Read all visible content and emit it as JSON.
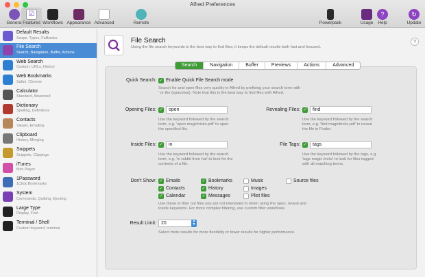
{
  "window": {
    "title": "Alfred Preferences"
  },
  "toolbar": {
    "left": [
      {
        "label": "General",
        "icon": "general-icon"
      },
      {
        "label": "Features",
        "icon": "features-icon"
      },
      {
        "label": "Workflows",
        "icon": "workflows-icon"
      },
      {
        "label": "Appearance",
        "icon": "appearance-icon"
      },
      {
        "label": "Advanced",
        "icon": "advanced-icon"
      },
      {
        "label": "Remote",
        "icon": "remote-icon"
      }
    ],
    "right": [
      {
        "label": "Powerpack",
        "icon": "powerpack-icon"
      },
      {
        "label": "Usage",
        "icon": "usage-icon"
      },
      {
        "label": "Help",
        "icon": "help-icon"
      },
      {
        "label": "Update",
        "icon": "update-icon"
      }
    ]
  },
  "sidebar": {
    "items": [
      {
        "name": "Default Results",
        "desc": "Scope, Types, Fallbacks",
        "color": "#6a5acd"
      },
      {
        "name": "File Search",
        "desc": "Search, Navigation, Buffer, Actions",
        "color": "#8e44ad"
      },
      {
        "name": "Web Search",
        "desc": "Custom, URLs, History",
        "color": "#2d7fd1"
      },
      {
        "name": "Web Bookmarks",
        "desc": "Safari, Chrome",
        "color": "#2d7fd1"
      },
      {
        "name": "Calculator",
        "desc": "Standard, Advanced",
        "color": "#555"
      },
      {
        "name": "Dictionary",
        "desc": "Spelling, Definitions",
        "color": "#b03a2e"
      },
      {
        "name": "Contacts",
        "desc": "Viewer, Emailing",
        "color": "#b8865b"
      },
      {
        "name": "Clipboard",
        "desc": "History, Merging",
        "color": "#777"
      },
      {
        "name": "Snippets",
        "desc": "Snippets, Clippings",
        "color": "#c49a2c"
      },
      {
        "name": "iTunes",
        "desc": "Mini Player",
        "color": "#d14fa6"
      },
      {
        "name": "1Password",
        "desc": "1Click Bookmarks",
        "color": "#3d6db5"
      },
      {
        "name": "System",
        "desc": "Commands, Quitting, Ejecting",
        "color": "#7a3fb5"
      },
      {
        "name": "Large Type",
        "desc": "Display, Font",
        "color": "#222"
      },
      {
        "name": "Terminal / Shell",
        "desc": "Custom keyword, terminal",
        "color": "#222"
      }
    ]
  },
  "header": {
    "title": "File Search",
    "subtitle": "Using the file search keywords is the best way to find files; it keeps the default results both fast and focused."
  },
  "tabs": [
    "Search",
    "Navigation",
    "Buffer",
    "Previews",
    "Actions",
    "Advanced"
  ],
  "form": {
    "quick_search": {
      "label": "Quick Search:",
      "option": "Enable Quick File Search mode",
      "help1": "Search for and open files very quickly in Alfred by prefixing your search term with",
      "help2": "' or the {spacebar}. Note that this is the best way to find files with Alfred."
    },
    "opening": {
      "label": "Opening Files:",
      "value": "open",
      "help1": "Use the keyword followed by the search",
      "help2": "term, e.g. 'open magictricks.pdf' to open",
      "help3": "the specified file."
    },
    "revealing": {
      "label": "Revealing Files:",
      "value": "find",
      "help1": "Use the keyword followed by the search",
      "help2": "term, e.g. 'find magictricks.pdf' to reveal",
      "help3": "the file in Finder."
    },
    "inside": {
      "label": "Inside Files:",
      "value": "in",
      "help1": "Use the keyword followed by the search",
      "help2": "term, e.g. 'in rabbit from hat' to look for the",
      "help3": "contents of a file."
    },
    "tags": {
      "label": "File Tags:",
      "value": "tags",
      "help1": "Use the keyword followed by the tags, e.g.",
      "help2": "'tags magic tricks' to look for files tagged",
      "help3": "with all matching terms."
    },
    "dont_show": {
      "label": "Don't Show:",
      "col1": [
        "Emails",
        "Contacts",
        "Calendar"
      ],
      "col2": [
        "Bookmarks",
        "History",
        "Messages"
      ],
      "col3": [
        "Music",
        "Images",
        "Plist files"
      ],
      "col4": [
        "Source files"
      ],
      "help1": "Use these to filter out files you are not interested in when using the open, reveal and",
      "help2": "inside keywords. For more complex filtering, use custom filter workflows."
    },
    "result_limit": {
      "label": "Result Limit:",
      "value": "20",
      "help": "Select more results for more flexibility or fewer results for higher performance."
    }
  }
}
